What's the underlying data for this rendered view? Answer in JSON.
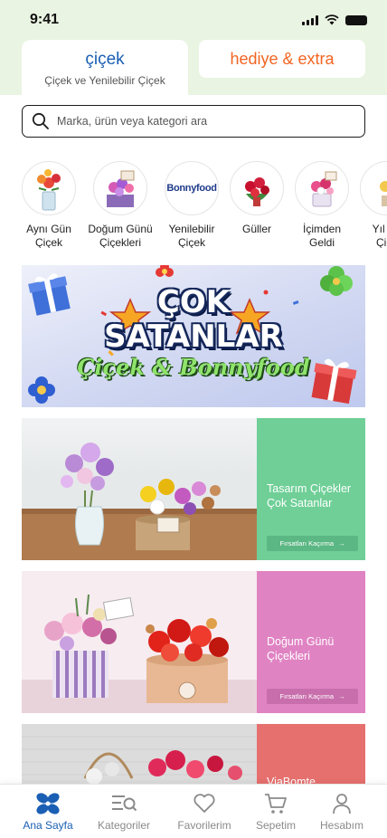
{
  "status_bar": {
    "time": "9:41"
  },
  "header": {
    "tab_cicek": {
      "title": "çiçek",
      "subtitle": "Çiçek ve Yenilebilir Çiçek"
    },
    "tab_hediye": {
      "title": "hediye & extra"
    }
  },
  "search": {
    "placeholder": "Marka, ürün veya kategori ara"
  },
  "categories": [
    {
      "line1": "Aynı Gün",
      "line2": "Çiçek"
    },
    {
      "line1": "Doğum Günü",
      "line2": "Çiçekleri"
    },
    {
      "line1": "Yenilebilir",
      "line2": "Çiçek",
      "logo_text": "Bonnyfood"
    },
    {
      "line1": "Güller",
      "line2": ""
    },
    {
      "line1": "İçimden",
      "line2": "Geldi"
    },
    {
      "line1": "Yıl Dö",
      "line2": "Çiçe"
    }
  ],
  "main_banner": {
    "line1": "ÇOK",
    "line2": "SATANLAR",
    "subtitle": "Çiçek & Bonnyfood"
  },
  "promos": [
    {
      "text": "Tasarım Çiçekler Çok Satanlar",
      "button": "Fırsatları Kaçırma",
      "color": "#6fcf97",
      "button_color": "#5bb783"
    },
    {
      "text": "Doğum Günü Çiçekleri",
      "button": "Fırsatları Kaçırma",
      "color": "#e083c3",
      "button_color": "#c86eac"
    },
    {
      "text": "ViaBomte",
      "button": "",
      "color": "#e6706e",
      "button_color": "#d45a58"
    }
  ],
  "bottom_nav": [
    {
      "label": "Ana Sayfa",
      "icon": "home-flower-icon",
      "active": true
    },
    {
      "label": "Kategoriler",
      "icon": "categories-search-icon",
      "active": false
    },
    {
      "label": "Favorilerim",
      "icon": "heart-icon",
      "active": false
    },
    {
      "label": "Sepetim",
      "icon": "cart-icon",
      "active": false
    },
    {
      "label": "Hesabım",
      "icon": "user-icon",
      "active": false
    }
  ],
  "colors": {
    "header_bg": "#eaf4e2",
    "accent_blue": "#1a5fb4",
    "accent_orange": "#f26522"
  }
}
